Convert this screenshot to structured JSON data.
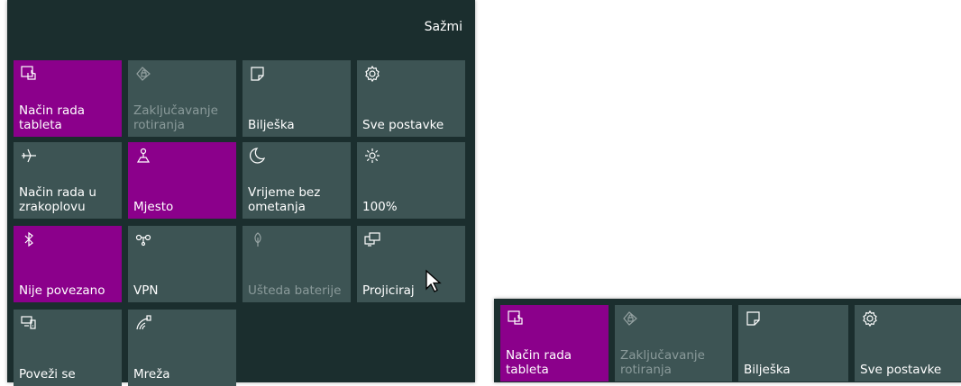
{
  "panel": {
    "collapse_label": "Sažmi",
    "tiles": [
      {
        "label": "Način rada\ntableta",
        "icon": "tablet-mode-icon",
        "state": "on"
      },
      {
        "label": "Zaključavanje\nrotiranja",
        "icon": "rotation-lock-icon",
        "state": "disabled"
      },
      {
        "label": "Bilješka",
        "icon": "note-icon",
        "state": "off"
      },
      {
        "label": "Sve postavke",
        "icon": "gear-icon",
        "state": "off"
      },
      {
        "label": "Način rada u\nzrakoplovu",
        "icon": "airplane-icon",
        "state": "off"
      },
      {
        "label": "Mjesto",
        "icon": "location-icon",
        "state": "on"
      },
      {
        "label": "Vrijeme bez\nometanja",
        "icon": "moon-icon",
        "state": "off"
      },
      {
        "label": "100%",
        "icon": "brightness-icon",
        "state": "off"
      },
      {
        "label": "Nije povezano",
        "icon": "bluetooth-icon",
        "state": "on"
      },
      {
        "label": "VPN",
        "icon": "vpn-icon",
        "state": "off"
      },
      {
        "label": "Ušteda baterije",
        "icon": "battery-saver-icon",
        "state": "disabled"
      },
      {
        "label": "Projiciraj",
        "icon": "project-icon",
        "state": "off"
      },
      {
        "label": "Poveži se",
        "icon": "connect-icon",
        "state": "off"
      },
      {
        "label": "Mreža",
        "icon": "network-icon",
        "state": "off"
      }
    ]
  },
  "collapsed_panel": {
    "tiles": [
      {
        "label": "Način rada\ntableta",
        "icon": "tablet-mode-icon",
        "state": "on"
      },
      {
        "label": "Zaključavanje\nrotiranja",
        "icon": "rotation-lock-icon",
        "state": "disabled"
      },
      {
        "label": "Bilješka",
        "icon": "note-icon",
        "state": "off"
      },
      {
        "label": "Sve postavke",
        "icon": "gear-icon",
        "state": "off"
      }
    ]
  },
  "colors": {
    "panel_bg": "#1b2e2e",
    "tile_bg": "#3d5454",
    "tile_on": "#8b008b",
    "text": "#ffffff",
    "text_disabled": "#8a9a9a"
  }
}
